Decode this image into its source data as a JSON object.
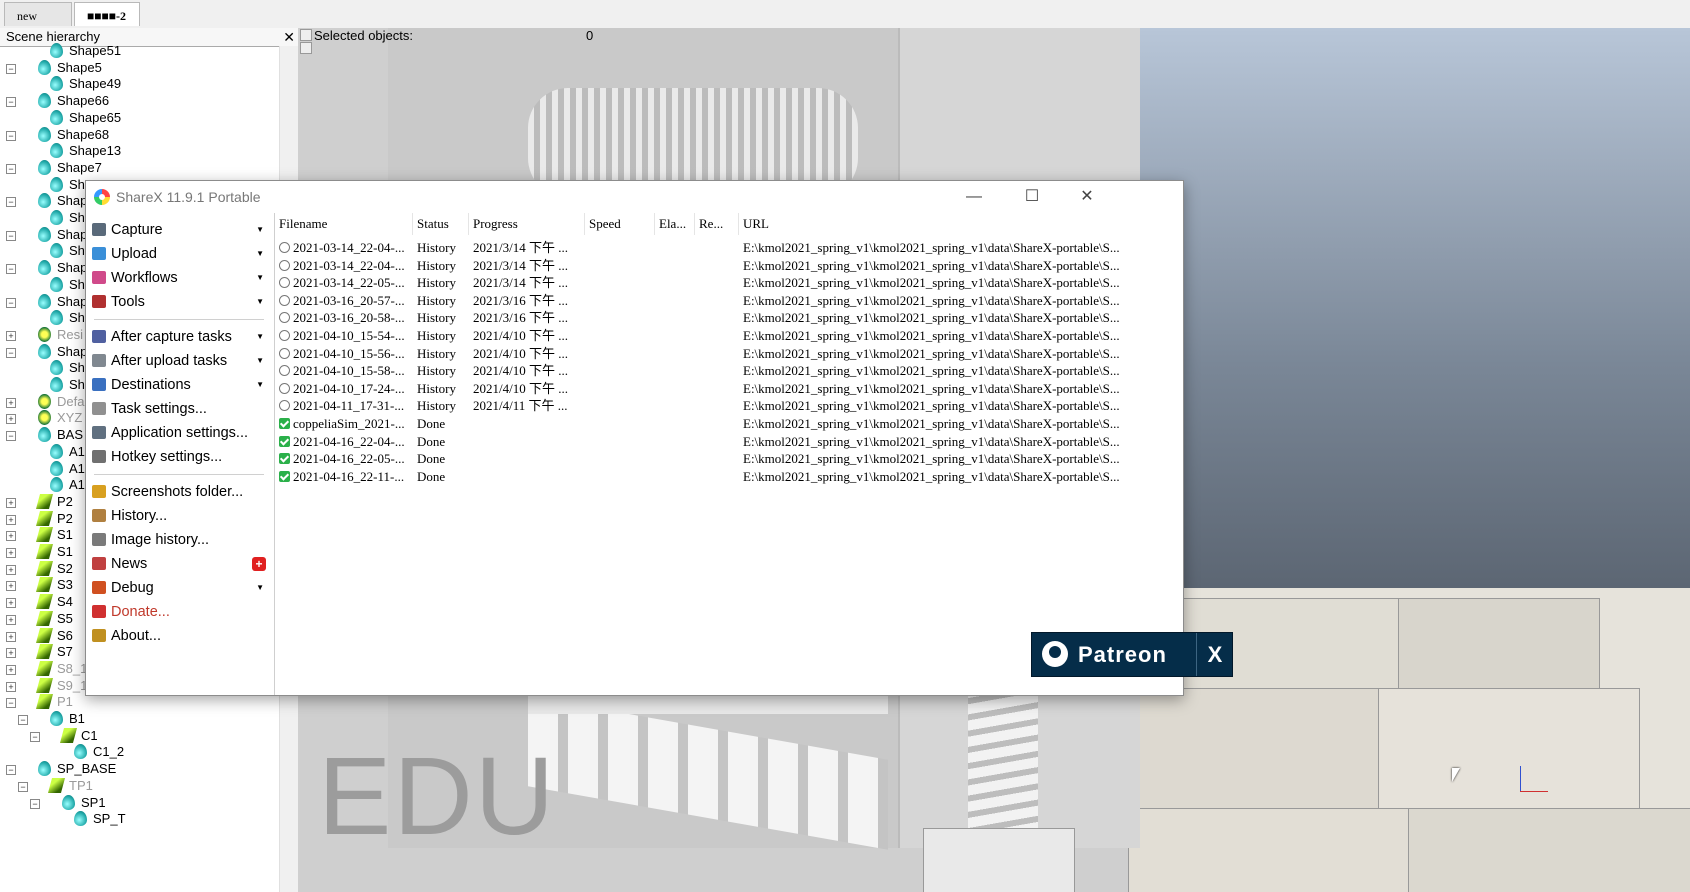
{
  "tabs": [
    {
      "label": "new scene"
    },
    {
      "label": "■■■■-2"
    }
  ],
  "hierarchy": {
    "title": "Scene hierarchy",
    "close": "✕",
    "items": [
      {
        "label": "Shape51",
        "icon": "shape-icon"
      },
      {
        "label": "Shape5",
        "icon": "shape-icon"
      },
      {
        "label": "Shape49",
        "icon": "shape-icon"
      },
      {
        "label": "Shape66",
        "icon": "shape-icon"
      },
      {
        "label": "Shape65",
        "icon": "shape-icon"
      },
      {
        "label": "Shape68",
        "icon": "shape-icon"
      },
      {
        "label": "Shape13",
        "icon": "shape-icon"
      },
      {
        "label": "Shape7",
        "icon": "shape-icon"
      },
      {
        "label": "Sh",
        "icon": "shape-icon"
      },
      {
        "label": "Shap",
        "icon": "shape-icon"
      },
      {
        "label": "Sh",
        "icon": "shape-icon"
      },
      {
        "label": "Shap",
        "icon": "shape-icon"
      },
      {
        "label": "Sh",
        "icon": "shape-icon"
      },
      {
        "label": "Shap",
        "icon": "shape-icon"
      },
      {
        "label": "Sh",
        "icon": "shape-icon"
      },
      {
        "label": "Shap",
        "icon": "shape-icon"
      },
      {
        "label": "Sh",
        "icon": "shape-icon"
      },
      {
        "label": "Resi",
        "icon": "dummy-icon"
      },
      {
        "label": "Shap",
        "icon": "shape-icon"
      },
      {
        "label": "Sh",
        "icon": "shape-icon"
      },
      {
        "label": "Sh",
        "icon": "shape-icon"
      },
      {
        "label": "Defa",
        "icon": "dummy-icon"
      },
      {
        "label": "XYZ",
        "icon": "dummy-icon"
      },
      {
        "label": "BAS",
        "icon": "shape-icon"
      },
      {
        "label": "A1",
        "icon": "shape-icon"
      },
      {
        "label": "A1",
        "icon": "shape-icon"
      },
      {
        "label": "A1",
        "icon": "shape-icon"
      },
      {
        "label": "P2",
        "icon": "path-icon"
      },
      {
        "label": "P2",
        "icon": "path-icon"
      },
      {
        "label": "S1",
        "icon": "path-icon"
      },
      {
        "label": "S1",
        "icon": "path-icon"
      },
      {
        "label": "S2",
        "icon": "path-icon"
      },
      {
        "label": "S3",
        "icon": "path-icon"
      },
      {
        "label": "S4",
        "icon": "path-icon"
      },
      {
        "label": "S5",
        "icon": "path-icon"
      },
      {
        "label": "S6",
        "icon": "path-icon"
      },
      {
        "label": "S7",
        "icon": "path-icon"
      },
      {
        "label": "S8_1",
        "icon": "path-icon"
      },
      {
        "label": "S9_1",
        "icon": "path-icon"
      },
      {
        "label": "P1",
        "icon": "path-icon"
      },
      {
        "label": "B1",
        "icon": "shape-icon"
      },
      {
        "label": "C1",
        "icon": "path-icon"
      },
      {
        "label": "C1_2",
        "icon": "shape-icon"
      },
      {
        "label": "SP_BASE",
        "icon": "shape-icon"
      },
      {
        "label": "TP1",
        "icon": "path-icon"
      },
      {
        "label": "SP1",
        "icon": "shape-icon"
      },
      {
        "label": "SP_T",
        "icon": "shape-icon"
      }
    ]
  },
  "view": {
    "selected_label": "Selected objects:",
    "selected_count": "0",
    "watermark": "EDU"
  },
  "sharex": {
    "title": "ShareX 11.9.1 Portable",
    "controls": {
      "minimize": "—",
      "maximize": "☐",
      "close": "✕"
    },
    "menu": [
      {
        "label": "Capture",
        "icon": "camera-icon",
        "arrow": true
      },
      {
        "label": "Upload",
        "icon": "upload-icon",
        "arrow": true
      },
      {
        "label": "Workflows",
        "icon": "workflows-icon",
        "arrow": true
      },
      {
        "label": "Tools",
        "icon": "toolbox-icon",
        "arrow": true
      },
      {
        "label": "After capture tasks",
        "icon": "after-capture-icon",
        "arrow": true
      },
      {
        "label": "After upload tasks",
        "icon": "cloud-icon",
        "arrow": true
      },
      {
        "label": "Destinations",
        "icon": "destinations-icon",
        "arrow": true
      },
      {
        "label": "Task settings...",
        "icon": "gear-icon",
        "arrow": false
      },
      {
        "label": "Application settings...",
        "icon": "wrench-icon",
        "arrow": false
      },
      {
        "label": "Hotkey settings...",
        "icon": "keyboard-icon",
        "arrow": false
      },
      {
        "label": "Screenshots folder...",
        "icon": "folder-icon",
        "arrow": false
      },
      {
        "label": "History...",
        "icon": "history-icon",
        "arrow": false
      },
      {
        "label": "Image history...",
        "icon": "image-history-icon",
        "arrow": false
      },
      {
        "label": "News",
        "icon": "news-icon",
        "arrow": false,
        "badge": "+"
      },
      {
        "label": "Debug",
        "icon": "debug-icon",
        "arrow": true
      },
      {
        "label": "Donate...",
        "icon": "heart-icon",
        "arrow": false
      },
      {
        "label": "About...",
        "icon": "about-icon",
        "arrow": false
      }
    ],
    "columns": [
      "Filename",
      "Status",
      "Progress",
      "Speed",
      "Ela...",
      "Re...",
      "URL"
    ],
    "rows": [
      {
        "filename": "2021-03-14_22-04-...",
        "status": "History",
        "progress": "2021/3/14 下午 ...",
        "url": "E:\\kmol2021_spring_v1\\kmol2021_spring_v1\\data\\ShareX-portable\\S...",
        "state": "history"
      },
      {
        "filename": "2021-03-14_22-04-...",
        "status": "History",
        "progress": "2021/3/14 下午 ...",
        "url": "E:\\kmol2021_spring_v1\\kmol2021_spring_v1\\data\\ShareX-portable\\S...",
        "state": "history"
      },
      {
        "filename": "2021-03-14_22-05-...",
        "status": "History",
        "progress": "2021/3/14 下午 ...",
        "url": "E:\\kmol2021_spring_v1\\kmol2021_spring_v1\\data\\ShareX-portable\\S...",
        "state": "history"
      },
      {
        "filename": "2021-03-16_20-57-...",
        "status": "History",
        "progress": "2021/3/16 下午 ...",
        "url": "E:\\kmol2021_spring_v1\\kmol2021_spring_v1\\data\\ShareX-portable\\S...",
        "state": "history"
      },
      {
        "filename": "2021-03-16_20-58-...",
        "status": "History",
        "progress": "2021/3/16 下午 ...",
        "url": "E:\\kmol2021_spring_v1\\kmol2021_spring_v1\\data\\ShareX-portable\\S...",
        "state": "history"
      },
      {
        "filename": "2021-04-10_15-54-...",
        "status": "History",
        "progress": "2021/4/10 下午 ...",
        "url": "E:\\kmol2021_spring_v1\\kmol2021_spring_v1\\data\\ShareX-portable\\S...",
        "state": "history"
      },
      {
        "filename": "2021-04-10_15-56-...",
        "status": "History",
        "progress": "2021/4/10 下午 ...",
        "url": "E:\\kmol2021_spring_v1\\kmol2021_spring_v1\\data\\ShareX-portable\\S...",
        "state": "history"
      },
      {
        "filename": "2021-04-10_15-58-...",
        "status": "History",
        "progress": "2021/4/10 下午 ...",
        "url": "E:\\kmol2021_spring_v1\\kmol2021_spring_v1\\data\\ShareX-portable\\S...",
        "state": "history"
      },
      {
        "filename": "2021-04-10_17-24-...",
        "status": "History",
        "progress": "2021/4/10 下午 ...",
        "url": "E:\\kmol2021_spring_v1\\kmol2021_spring_v1\\data\\ShareX-portable\\S...",
        "state": "history"
      },
      {
        "filename": "2021-04-11_17-31-...",
        "status": "History",
        "progress": "2021/4/11 下午 ...",
        "url": "E:\\kmol2021_spring_v1\\kmol2021_spring_v1\\data\\ShareX-portable\\S...",
        "state": "history"
      },
      {
        "filename": "coppeliaSim_2021-...",
        "status": "Done",
        "progress": "",
        "url": "E:\\kmol2021_spring_v1\\kmol2021_spring_v1\\data\\ShareX-portable\\S...",
        "state": "done"
      },
      {
        "filename": "2021-04-16_22-04-...",
        "status": "Done",
        "progress": "",
        "url": "E:\\kmol2021_spring_v1\\kmol2021_spring_v1\\data\\ShareX-portable\\S...",
        "state": "done"
      },
      {
        "filename": "2021-04-16_22-05-...",
        "status": "Done",
        "progress": "",
        "url": "E:\\kmol2021_spring_v1\\kmol2021_spring_v1\\data\\ShareX-portable\\S...",
        "state": "done"
      },
      {
        "filename": "2021-04-16_22-11-...",
        "status": "Done",
        "progress": "",
        "url": "E:\\kmol2021_spring_v1\\kmol2021_spring_v1\\data\\ShareX-portable\\S...",
        "state": "done"
      }
    ],
    "patreon": {
      "label": "Patreon",
      "close": "X"
    }
  },
  "colors": {
    "donate": "#c0392b",
    "done": "#2bb04a",
    "patreon_bg": "#052d49"
  }
}
